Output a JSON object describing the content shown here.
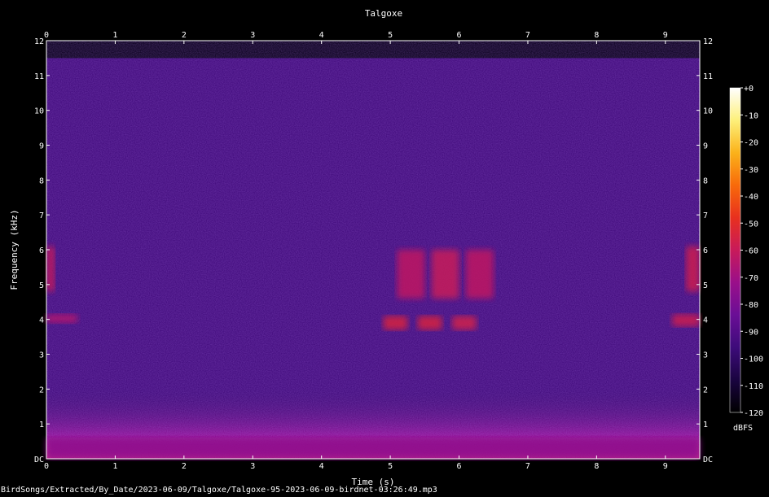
{
  "chart_data": {
    "type": "heatmap",
    "title": "Talgoxe",
    "xlabel": "Time (s)",
    "ylabel": "Frequency (kHz)",
    "xlim": [
      0,
      9.5
    ],
    "ylim": [
      0,
      12
    ],
    "x_ticks": [
      "0",
      "1",
      "2",
      "3",
      "4",
      "5",
      "6",
      "7",
      "8",
      "9"
    ],
    "y_ticks": [
      "DC",
      "1",
      "2",
      "3",
      "4",
      "5",
      "6",
      "7",
      "8",
      "9",
      "10",
      "11",
      "12"
    ],
    "colorbar": {
      "label": "dBFS",
      "ticks": [
        "+0",
        "-10",
        "-20",
        "-30",
        "-40",
        "-50",
        "-60",
        "-70",
        "-80",
        "-90",
        "-100",
        "-110",
        "-120"
      ],
      "range": [
        -120,
        0
      ],
      "colors": [
        "#000000",
        "#1a0440",
        "#3d0b7a",
        "#6a0e96",
        "#9a0f8a",
        "#c81a5a",
        "#e8301e",
        "#f86a0a",
        "#fbb21a",
        "#fdf07a",
        "#ffffff"
      ]
    },
    "background_level_dbfs": -95,
    "events": [
      {
        "t0": 0.0,
        "t1": 0.12,
        "f0": 4.8,
        "f1": 6.1,
        "dbfs": -60
      },
      {
        "t0": 0.0,
        "t1": 0.45,
        "f0": 3.9,
        "f1": 4.15,
        "dbfs": -65
      },
      {
        "t0": 5.1,
        "t1": 5.5,
        "f0": 4.6,
        "f1": 6.0,
        "dbfs": -62
      },
      {
        "t0": 4.9,
        "t1": 5.25,
        "f0": 3.7,
        "f1": 4.1,
        "dbfs": -55
      },
      {
        "t0": 5.6,
        "t1": 6.0,
        "f0": 4.6,
        "f1": 6.0,
        "dbfs": -60
      },
      {
        "t0": 5.4,
        "t1": 5.75,
        "f0": 3.7,
        "f1": 4.1,
        "dbfs": -55
      },
      {
        "t0": 6.1,
        "t1": 6.5,
        "f0": 4.6,
        "f1": 6.0,
        "dbfs": -62
      },
      {
        "t0": 5.9,
        "t1": 6.25,
        "f0": 3.7,
        "f1": 4.1,
        "dbfs": -57
      },
      {
        "t0": 9.3,
        "t1": 9.5,
        "f0": 4.8,
        "f1": 6.1,
        "dbfs": -58
      },
      {
        "t0": 9.1,
        "t1": 9.5,
        "f0": 3.8,
        "f1": 4.15,
        "dbfs": -58
      },
      {
        "t0": 0.0,
        "t1": 9.5,
        "f0": 0.0,
        "f1": 0.6,
        "dbfs": -75
      }
    ]
  },
  "footer": "BirdSongs/Extracted/By_Date/2023-06-09/Talgoxe/Talgoxe-95-2023-06-09-birdnet-03:26:49.mp3"
}
